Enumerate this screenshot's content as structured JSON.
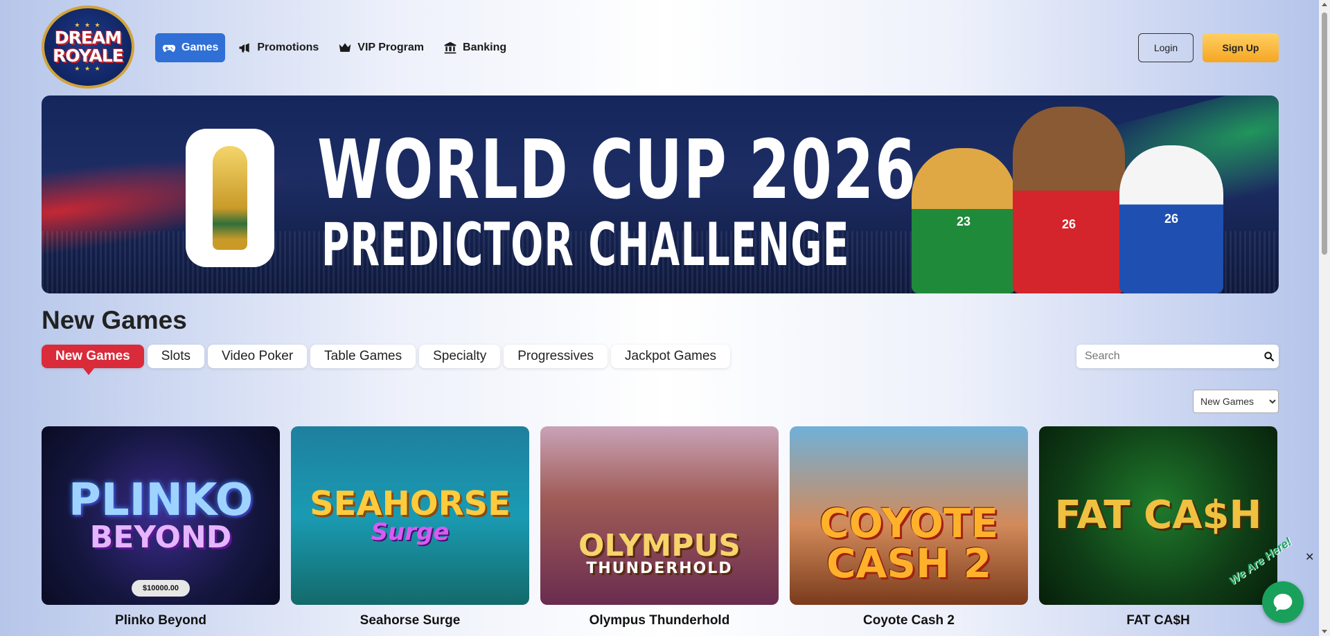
{
  "brand": {
    "line1": "DREAM",
    "line2": "ROYALE"
  },
  "nav": [
    {
      "label": "Games",
      "icon": "gamepad-icon",
      "active": true
    },
    {
      "label": "Promotions",
      "icon": "megaphone-icon",
      "active": false
    },
    {
      "label": "VIP Program",
      "icon": "crown-icon",
      "active": false
    },
    {
      "label": "Banking",
      "icon": "bank-icon",
      "active": false
    }
  ],
  "auth": {
    "login_label": "Login",
    "signup_label": "Sign Up"
  },
  "banner": {
    "line1": "WORLD CUP 2026",
    "line2": "PREDICTOR CHALLENGE",
    "mascot_numbers": [
      "23",
      "26",
      "26"
    ]
  },
  "section": {
    "title": "New Games"
  },
  "tabs": [
    "New Games",
    "Slots",
    "Video Poker",
    "Table Games",
    "Specialty",
    "Progressives",
    "Jackpot Games"
  ],
  "active_tab": "New Games",
  "search": {
    "placeholder": "Search",
    "value": ""
  },
  "sort": {
    "selected": "New Games"
  },
  "games": [
    {
      "name": "Plinko Beyond",
      "thumb_title": "PLINKO",
      "thumb_sub": "BEYOND",
      "jackpot": "$10000.00"
    },
    {
      "name": "Seahorse Surge",
      "thumb_title": "SEAHORSE",
      "thumb_sub": "Surge"
    },
    {
      "name": "Olympus Thunderhold",
      "thumb_title": "OLYMPUS",
      "thumb_sub": "THUNDERHOLD"
    },
    {
      "name": "Coyote Cash 2",
      "thumb_title": "COYOTE",
      "thumb_sub": "CASH 2"
    },
    {
      "name": "FAT CA$H",
      "thumb_title": "FAT CA$H",
      "thumb_sub": ""
    }
  ],
  "chat": {
    "tag": "We Are Here!"
  },
  "colors": {
    "accent_blue": "#2f6fd6",
    "active_tab_red": "#d92b3a",
    "signup_gold": "#f5a623",
    "chat_green": "#19a05a"
  }
}
